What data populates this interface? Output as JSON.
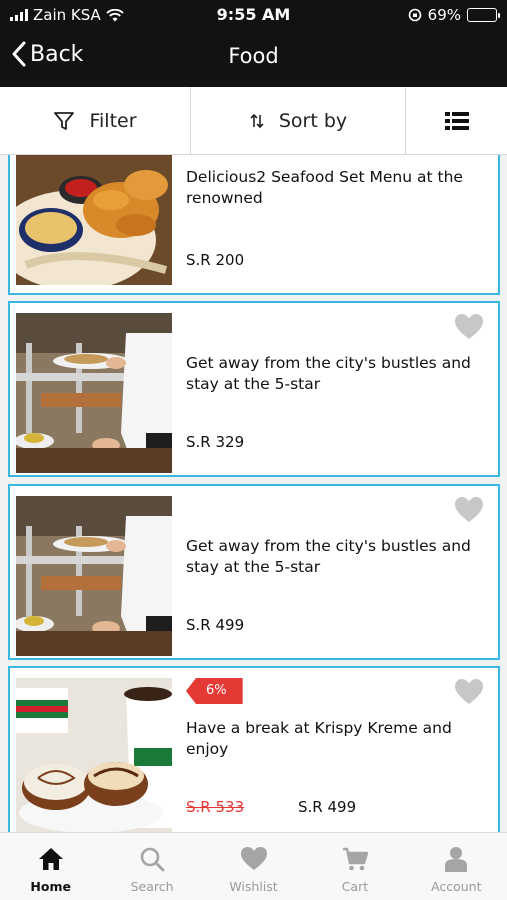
{
  "status_bar": {
    "carrier": "Zain KSA",
    "time": "9:55 AM",
    "battery": "69%",
    "battery_level": 0.69
  },
  "header": {
    "back_label": "Back",
    "title": "Food"
  },
  "toolbar": {
    "filter_label": "Filter",
    "sort_label": "Sort by",
    "view_icon": "list-view-icon"
  },
  "items": [
    {
      "title": "Delicious2 Seafood Set Menu at the renowned",
      "price": "S.R 200"
    },
    {
      "title": "Get away from the city's bustles and stay at the 5-star",
      "price": "S.R 329"
    },
    {
      "title": "Get away from the city's bustles and stay at the 5-star",
      "price": "S.R 499"
    },
    {
      "badge": "6%",
      "title": "Have a break at Krispy Kreme and enjoy",
      "old_price": "S.R 533",
      "price": "S.R 499"
    }
  ],
  "tabs": [
    {
      "label": "Home",
      "icon": "home-icon",
      "active": true
    },
    {
      "label": "Search",
      "icon": "search-icon",
      "active": false
    },
    {
      "label": "Wishlist",
      "icon": "heart-icon",
      "active": false
    },
    {
      "label": "Cart",
      "icon": "cart-icon",
      "active": false
    },
    {
      "label": "Account",
      "icon": "account-icon",
      "active": false
    }
  ],
  "colors": {
    "header_bg": "#121212",
    "card_border": "#38b8e0",
    "badge": "#e53935",
    "strike_price": "#e53935"
  }
}
